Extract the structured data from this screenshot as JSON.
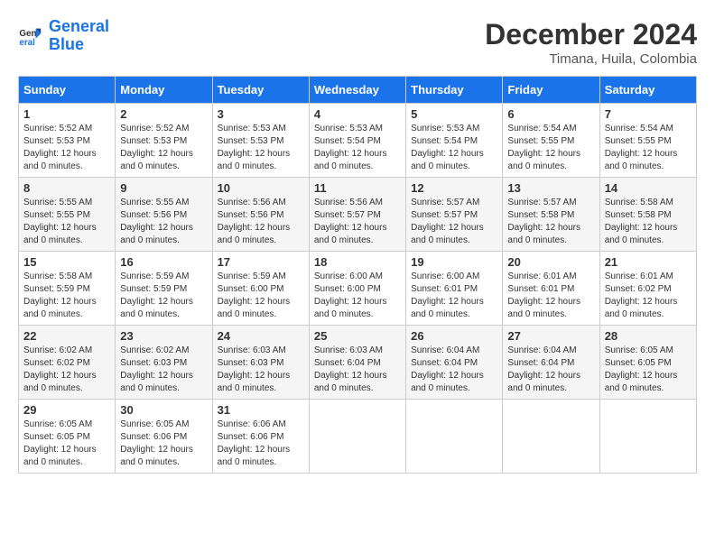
{
  "logo": {
    "line1": "General",
    "line2": "Blue"
  },
  "title": {
    "month": "December 2024",
    "location": "Timana, Huila, Colombia"
  },
  "headers": [
    "Sunday",
    "Monday",
    "Tuesday",
    "Wednesday",
    "Thursday",
    "Friday",
    "Saturday"
  ],
  "weeks": [
    [
      {
        "day": "1",
        "sunrise": "5:52 AM",
        "sunset": "5:53 PM",
        "daylight": "12 hours and 0 minutes."
      },
      {
        "day": "2",
        "sunrise": "5:52 AM",
        "sunset": "5:53 PM",
        "daylight": "12 hours and 0 minutes."
      },
      {
        "day": "3",
        "sunrise": "5:53 AM",
        "sunset": "5:53 PM",
        "daylight": "12 hours and 0 minutes."
      },
      {
        "day": "4",
        "sunrise": "5:53 AM",
        "sunset": "5:54 PM",
        "daylight": "12 hours and 0 minutes."
      },
      {
        "day": "5",
        "sunrise": "5:53 AM",
        "sunset": "5:54 PM",
        "daylight": "12 hours and 0 minutes."
      },
      {
        "day": "6",
        "sunrise": "5:54 AM",
        "sunset": "5:55 PM",
        "daylight": "12 hours and 0 minutes."
      },
      {
        "day": "7",
        "sunrise": "5:54 AM",
        "sunset": "5:55 PM",
        "daylight": "12 hours and 0 minutes."
      }
    ],
    [
      {
        "day": "8",
        "sunrise": "5:55 AM",
        "sunset": "5:55 PM",
        "daylight": "12 hours and 0 minutes."
      },
      {
        "day": "9",
        "sunrise": "5:55 AM",
        "sunset": "5:56 PM",
        "daylight": "12 hours and 0 minutes."
      },
      {
        "day": "10",
        "sunrise": "5:56 AM",
        "sunset": "5:56 PM",
        "daylight": "12 hours and 0 minutes."
      },
      {
        "day": "11",
        "sunrise": "5:56 AM",
        "sunset": "5:57 PM",
        "daylight": "12 hours and 0 minutes."
      },
      {
        "day": "12",
        "sunrise": "5:57 AM",
        "sunset": "5:57 PM",
        "daylight": "12 hours and 0 minutes."
      },
      {
        "day": "13",
        "sunrise": "5:57 AM",
        "sunset": "5:58 PM",
        "daylight": "12 hours and 0 minutes."
      },
      {
        "day": "14",
        "sunrise": "5:58 AM",
        "sunset": "5:58 PM",
        "daylight": "12 hours and 0 minutes."
      }
    ],
    [
      {
        "day": "15",
        "sunrise": "5:58 AM",
        "sunset": "5:59 PM",
        "daylight": "12 hours and 0 minutes."
      },
      {
        "day": "16",
        "sunrise": "5:59 AM",
        "sunset": "5:59 PM",
        "daylight": "12 hours and 0 minutes."
      },
      {
        "day": "17",
        "sunrise": "5:59 AM",
        "sunset": "6:00 PM",
        "daylight": "12 hours and 0 minutes."
      },
      {
        "day": "18",
        "sunrise": "6:00 AM",
        "sunset": "6:00 PM",
        "daylight": "12 hours and 0 minutes."
      },
      {
        "day": "19",
        "sunrise": "6:00 AM",
        "sunset": "6:01 PM",
        "daylight": "12 hours and 0 minutes."
      },
      {
        "day": "20",
        "sunrise": "6:01 AM",
        "sunset": "6:01 PM",
        "daylight": "12 hours and 0 minutes."
      },
      {
        "day": "21",
        "sunrise": "6:01 AM",
        "sunset": "6:02 PM",
        "daylight": "12 hours and 0 minutes."
      }
    ],
    [
      {
        "day": "22",
        "sunrise": "6:02 AM",
        "sunset": "6:02 PM",
        "daylight": "12 hours and 0 minutes."
      },
      {
        "day": "23",
        "sunrise": "6:02 AM",
        "sunset": "6:03 PM",
        "daylight": "12 hours and 0 minutes."
      },
      {
        "day": "24",
        "sunrise": "6:03 AM",
        "sunset": "6:03 PM",
        "daylight": "12 hours and 0 minutes."
      },
      {
        "day": "25",
        "sunrise": "6:03 AM",
        "sunset": "6:04 PM",
        "daylight": "12 hours and 0 minutes."
      },
      {
        "day": "26",
        "sunrise": "6:04 AM",
        "sunset": "6:04 PM",
        "daylight": "12 hours and 0 minutes."
      },
      {
        "day": "27",
        "sunrise": "6:04 AM",
        "sunset": "6:04 PM",
        "daylight": "12 hours and 0 minutes."
      },
      {
        "day": "28",
        "sunrise": "6:05 AM",
        "sunset": "6:05 PM",
        "daylight": "12 hours and 0 minutes."
      }
    ],
    [
      {
        "day": "29",
        "sunrise": "6:05 AM",
        "sunset": "6:05 PM",
        "daylight": "12 hours and 0 minutes."
      },
      {
        "day": "30",
        "sunrise": "6:05 AM",
        "sunset": "6:06 PM",
        "daylight": "12 hours and 0 minutes."
      },
      {
        "day": "31",
        "sunrise": "6:06 AM",
        "sunset": "6:06 PM",
        "daylight": "12 hours and 0 minutes."
      },
      null,
      null,
      null,
      null
    ]
  ]
}
